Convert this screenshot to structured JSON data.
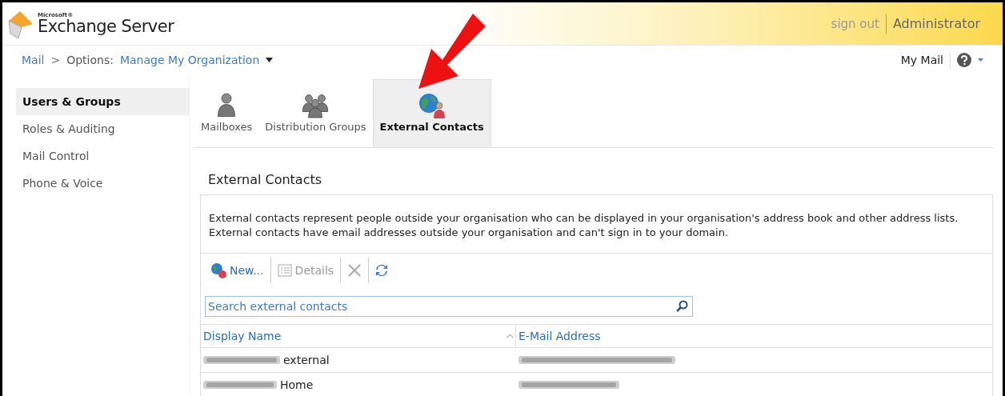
{
  "header": {
    "brand_small": "Microsoft®",
    "brand": "Exchange Server",
    "sign_out": "sign out",
    "user": "Administrator"
  },
  "breadcrumb": {
    "items": [
      "Mail",
      "Options:",
      "Manage My Organization"
    ],
    "separator": ">"
  },
  "top_right": {
    "link": "My Mail"
  },
  "sidebar": {
    "items": [
      {
        "label": "Users & Groups",
        "selected": true
      },
      {
        "label": "Roles & Auditing",
        "selected": false
      },
      {
        "label": "Mail Control",
        "selected": false
      },
      {
        "label": "Phone & Voice",
        "selected": false
      }
    ]
  },
  "tabs": [
    {
      "label": "Mailboxes",
      "kind": "person",
      "selected": false
    },
    {
      "label": "Distribution Groups",
      "kind": "group",
      "selected": false
    },
    {
      "label": "External Contacts",
      "kind": "globe",
      "selected": true
    }
  ],
  "section": {
    "title": "External Contacts",
    "description": "External contacts represent people outside your organisation who can be displayed in your organisation's address book and other address lists. External contacts have email addresses outside your organisation and can't sign in to your domain."
  },
  "toolbar": [
    {
      "kind": "new",
      "label": "New...",
      "disabled": false
    },
    {
      "kind": "details",
      "label": "Details",
      "disabled": true
    },
    {
      "kind": "delete",
      "disabled": true
    },
    {
      "kind": "refresh",
      "disabled": false
    }
  ],
  "search": {
    "placeholder": "Search external contacts"
  },
  "table": {
    "columns": [
      "Display Name",
      "E-Mail Address"
    ],
    "rows": [
      {
        "display_name": "external"
      },
      {
        "display_name": "Home"
      }
    ]
  }
}
